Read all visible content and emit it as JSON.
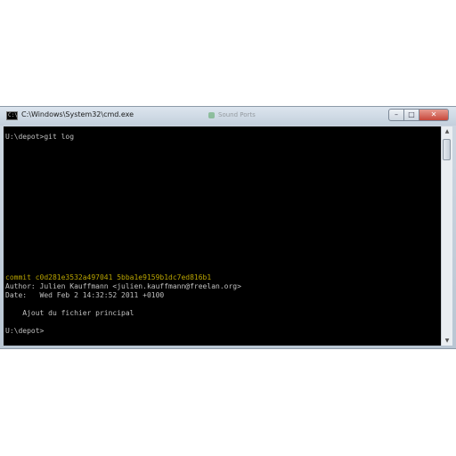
{
  "window": {
    "title": "C:\\Windows\\System32\\cmd.exe",
    "app_icon_text": "C:\\",
    "background_tab_title": "Sound Ports",
    "controls": {
      "minimize": "–",
      "maximize": "□",
      "close": "✕"
    }
  },
  "colors": {
    "console_background": "#000000",
    "console_text": "#c0c0c0",
    "commit_text": "#b8a300"
  },
  "console": {
    "lines": [
      "U:\\depot>git log",
      "commit c0d281e3532a497041 5bba1e9159b1dc7ed816b1",
      "Author: Julien Kauffmann <julien.kauffmann@freelan.org>",
      "Date:   Wed Feb 2 14:32:52 2011 +0100",
      "    Ajout du fichier principal",
      "U:\\depot>"
    ]
  },
  "scrollbar": {
    "up_icon": "▲",
    "down_icon": "▼"
  }
}
